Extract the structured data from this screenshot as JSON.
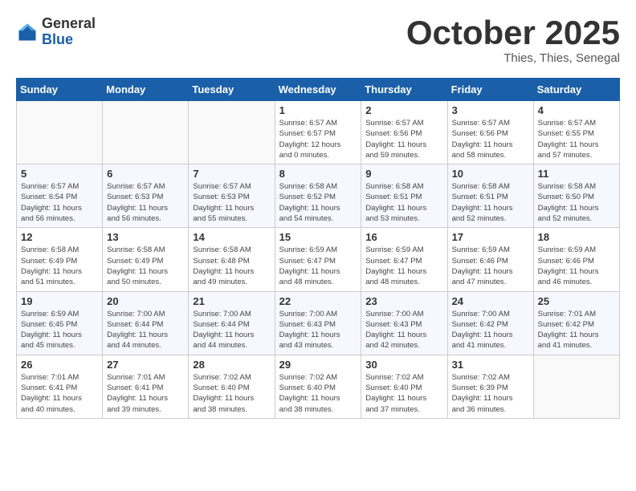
{
  "header": {
    "logo_general": "General",
    "logo_blue": "Blue",
    "month": "October 2025",
    "location": "Thies, Thies, Senegal"
  },
  "weekdays": [
    "Sunday",
    "Monday",
    "Tuesday",
    "Wednesday",
    "Thursday",
    "Friday",
    "Saturday"
  ],
  "weeks": [
    [
      {
        "day": "",
        "info": ""
      },
      {
        "day": "",
        "info": ""
      },
      {
        "day": "",
        "info": ""
      },
      {
        "day": "1",
        "info": "Sunrise: 6:57 AM\nSunset: 6:57 PM\nDaylight: 12 hours\nand 0 minutes."
      },
      {
        "day": "2",
        "info": "Sunrise: 6:57 AM\nSunset: 6:56 PM\nDaylight: 11 hours\nand 59 minutes."
      },
      {
        "day": "3",
        "info": "Sunrise: 6:57 AM\nSunset: 6:56 PM\nDaylight: 11 hours\nand 58 minutes."
      },
      {
        "day": "4",
        "info": "Sunrise: 6:57 AM\nSunset: 6:55 PM\nDaylight: 11 hours\nand 57 minutes."
      }
    ],
    [
      {
        "day": "5",
        "info": "Sunrise: 6:57 AM\nSunset: 6:54 PM\nDaylight: 11 hours\nand 56 minutes."
      },
      {
        "day": "6",
        "info": "Sunrise: 6:57 AM\nSunset: 6:53 PM\nDaylight: 11 hours\nand 56 minutes."
      },
      {
        "day": "7",
        "info": "Sunrise: 6:57 AM\nSunset: 6:53 PM\nDaylight: 11 hours\nand 55 minutes."
      },
      {
        "day": "8",
        "info": "Sunrise: 6:58 AM\nSunset: 6:52 PM\nDaylight: 11 hours\nand 54 minutes."
      },
      {
        "day": "9",
        "info": "Sunrise: 6:58 AM\nSunset: 6:51 PM\nDaylight: 11 hours\nand 53 minutes."
      },
      {
        "day": "10",
        "info": "Sunrise: 6:58 AM\nSunset: 6:51 PM\nDaylight: 11 hours\nand 52 minutes."
      },
      {
        "day": "11",
        "info": "Sunrise: 6:58 AM\nSunset: 6:50 PM\nDaylight: 11 hours\nand 52 minutes."
      }
    ],
    [
      {
        "day": "12",
        "info": "Sunrise: 6:58 AM\nSunset: 6:49 PM\nDaylight: 11 hours\nand 51 minutes."
      },
      {
        "day": "13",
        "info": "Sunrise: 6:58 AM\nSunset: 6:49 PM\nDaylight: 11 hours\nand 50 minutes."
      },
      {
        "day": "14",
        "info": "Sunrise: 6:58 AM\nSunset: 6:48 PM\nDaylight: 11 hours\nand 49 minutes."
      },
      {
        "day": "15",
        "info": "Sunrise: 6:59 AM\nSunset: 6:47 PM\nDaylight: 11 hours\nand 48 minutes."
      },
      {
        "day": "16",
        "info": "Sunrise: 6:59 AM\nSunset: 6:47 PM\nDaylight: 11 hours\nand 48 minutes."
      },
      {
        "day": "17",
        "info": "Sunrise: 6:59 AM\nSunset: 6:46 PM\nDaylight: 11 hours\nand 47 minutes."
      },
      {
        "day": "18",
        "info": "Sunrise: 6:59 AM\nSunset: 6:46 PM\nDaylight: 11 hours\nand 46 minutes."
      }
    ],
    [
      {
        "day": "19",
        "info": "Sunrise: 6:59 AM\nSunset: 6:45 PM\nDaylight: 11 hours\nand 45 minutes."
      },
      {
        "day": "20",
        "info": "Sunrise: 7:00 AM\nSunset: 6:44 PM\nDaylight: 11 hours\nand 44 minutes."
      },
      {
        "day": "21",
        "info": "Sunrise: 7:00 AM\nSunset: 6:44 PM\nDaylight: 11 hours\nand 44 minutes."
      },
      {
        "day": "22",
        "info": "Sunrise: 7:00 AM\nSunset: 6:43 PM\nDaylight: 11 hours\nand 43 minutes."
      },
      {
        "day": "23",
        "info": "Sunrise: 7:00 AM\nSunset: 6:43 PM\nDaylight: 11 hours\nand 42 minutes."
      },
      {
        "day": "24",
        "info": "Sunrise: 7:00 AM\nSunset: 6:42 PM\nDaylight: 11 hours\nand 41 minutes."
      },
      {
        "day": "25",
        "info": "Sunrise: 7:01 AM\nSunset: 6:42 PM\nDaylight: 11 hours\nand 41 minutes."
      }
    ],
    [
      {
        "day": "26",
        "info": "Sunrise: 7:01 AM\nSunset: 6:41 PM\nDaylight: 11 hours\nand 40 minutes."
      },
      {
        "day": "27",
        "info": "Sunrise: 7:01 AM\nSunset: 6:41 PM\nDaylight: 11 hours\nand 39 minutes."
      },
      {
        "day": "28",
        "info": "Sunrise: 7:02 AM\nSunset: 6:40 PM\nDaylight: 11 hours\nand 38 minutes."
      },
      {
        "day": "29",
        "info": "Sunrise: 7:02 AM\nSunset: 6:40 PM\nDaylight: 11 hours\nand 38 minutes."
      },
      {
        "day": "30",
        "info": "Sunrise: 7:02 AM\nSunset: 6:40 PM\nDaylight: 11 hours\nand 37 minutes."
      },
      {
        "day": "31",
        "info": "Sunrise: 7:02 AM\nSunset: 6:39 PM\nDaylight: 11 hours\nand 36 minutes."
      },
      {
        "day": "",
        "info": ""
      }
    ]
  ]
}
